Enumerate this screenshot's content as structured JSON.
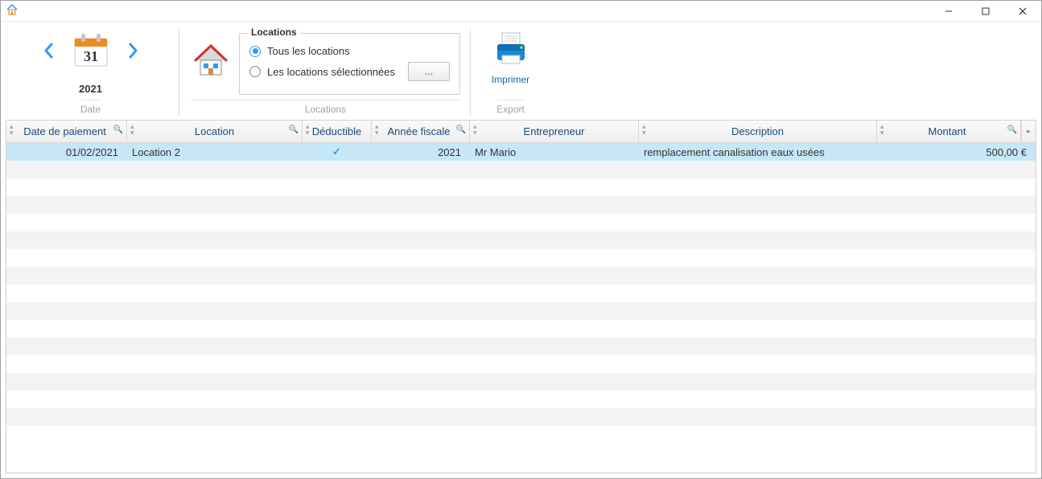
{
  "titlebar": {
    "app_icon": "home-icon"
  },
  "toolbar": {
    "date": {
      "year": "2021",
      "caption": "Date"
    },
    "locations": {
      "legend": "Locations",
      "opt_all": "Tous les locations",
      "opt_sel": "Les locations sélectionnées",
      "select_btn": "...",
      "caption": "Locations"
    },
    "export": {
      "label": "Imprimer",
      "caption": "Export"
    }
  },
  "grid": {
    "headers": {
      "date": "Date de paiement",
      "location": "Location",
      "deductible": "Déductible",
      "fiscal": "Année fiscale",
      "entrepreneur": "Entrepreneur",
      "description": "Description",
      "amount": "Montant"
    },
    "rows": [
      {
        "date": "01/02/2021",
        "location": "Location 2",
        "deductible": true,
        "fiscal": "2021",
        "entrepreneur": "Mr Mario",
        "description": "remplacement canalisation eaux usées",
        "amount": "500,00 €"
      }
    ]
  }
}
